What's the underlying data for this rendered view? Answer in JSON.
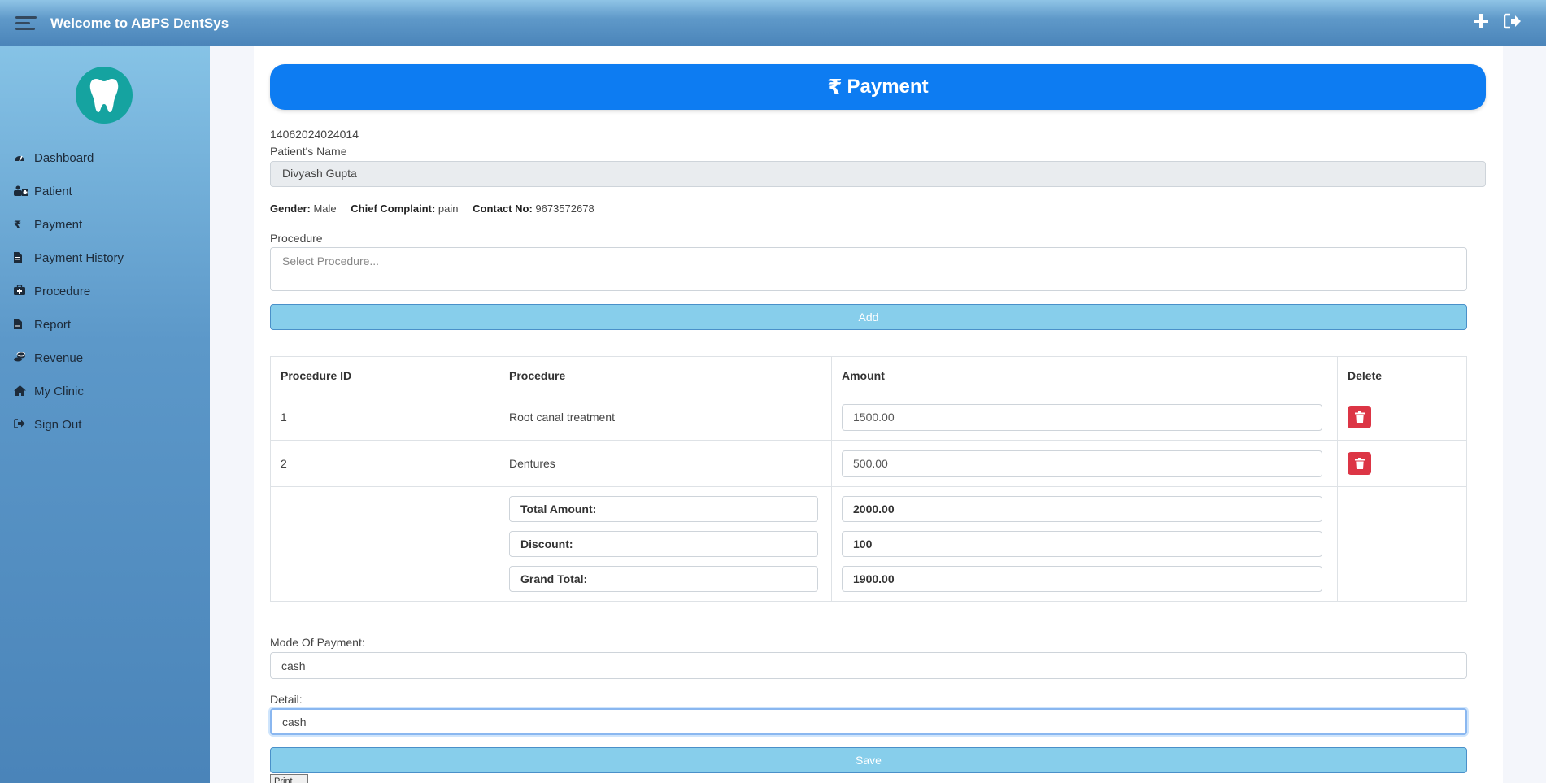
{
  "topbar": {
    "title": "Welcome to ABPS DentSys"
  },
  "sidebar": {
    "items": [
      {
        "label": "Dashboard",
        "icon": "dashboard-icon"
      },
      {
        "label": "Patient",
        "icon": "patient-icon"
      },
      {
        "label": "Payment",
        "icon": "rupee-icon"
      },
      {
        "label": "Payment History",
        "icon": "file-icon"
      },
      {
        "label": "Procedure",
        "icon": "medkit-icon"
      },
      {
        "label": "Report",
        "icon": "file-icon"
      },
      {
        "label": "Revenue",
        "icon": "coins-icon"
      },
      {
        "label": "My Clinic",
        "icon": "home-icon"
      },
      {
        "label": "Sign Out",
        "icon": "sign-out-icon"
      }
    ]
  },
  "page": {
    "title": "Payment",
    "patient_id": "14062024024014",
    "patient_name_label": "Patient's Name",
    "patient_name": "Divyash Gupta",
    "gender_label": "Gender:",
    "gender": "Male",
    "complaint_label": "Chief Complaint:",
    "complaint": "pain",
    "contact_label": "Contact No:",
    "contact": "9673572678",
    "procedure_label": "Procedure",
    "procedure_placeholder": "Select Procedure...",
    "add_label": "Add",
    "table": {
      "headers": [
        "Procedure ID",
        "Procedure",
        "Amount",
        "Delete"
      ],
      "rows": [
        {
          "id": "1",
          "procedure": "Root canal treatment",
          "amount": "1500.00"
        },
        {
          "id": "2",
          "procedure": "Dentures",
          "amount": "500.00"
        }
      ],
      "total_label": "Total Amount:",
      "total": "2000.00",
      "discount_label": "Discount:",
      "discount": "100",
      "grand_label": "Grand Total:",
      "grand": "1900.00"
    },
    "mode_label": "Mode Of Payment:",
    "mode": "cash",
    "detail_label": "Detail:",
    "detail": "cash",
    "save_label": "Save",
    "print_label": "Print"
  },
  "colors": {
    "accent": "#0d7cf2",
    "danger": "#dc3545",
    "button": "#87ceeb",
    "logo": "#15a3a0"
  }
}
